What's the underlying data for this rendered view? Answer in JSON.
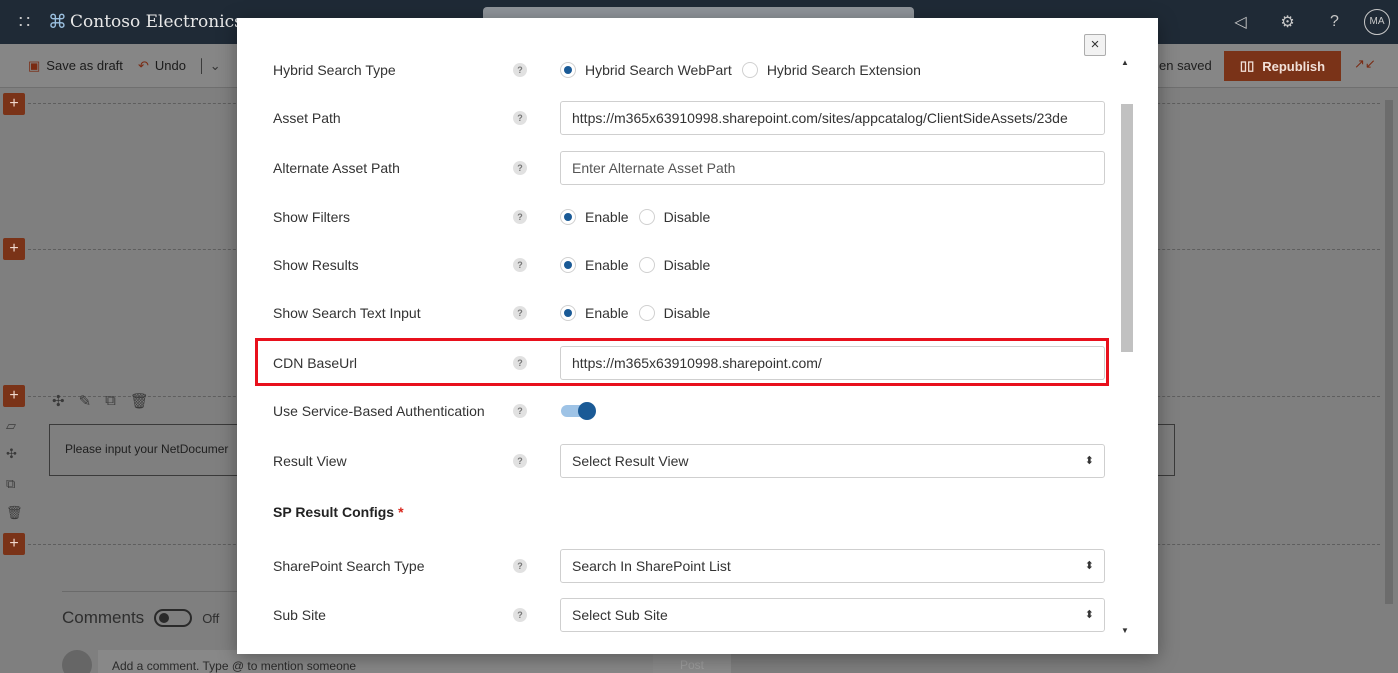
{
  "suitebar": {
    "waffle": "∷",
    "logo_glyph": "⌘",
    "brand": "Contoso Electronics",
    "avatar_initials": "MA"
  },
  "cmdbar": {
    "save_draft": "Save as draft",
    "undo": "Undo",
    "saved_status": "en saved",
    "republish": "Republish"
  },
  "page": {
    "input_text": "Please input your NetDocumer",
    "comments_title": "Comments",
    "comments_toggle": "Off",
    "comment_placeholder": "Add a comment. Type @ to mention someone",
    "post_label": "Post"
  },
  "modal": {
    "close": "×",
    "help_glyph": "?",
    "hybrid_search_type": {
      "label": "Hybrid Search Type",
      "options": [
        "Hybrid Search WebPart",
        "Hybrid Search Extension"
      ],
      "selected": "Hybrid Search WebPart"
    },
    "asset_path": {
      "label": "Asset Path",
      "value": "https://m365x63910998.sharepoint.com/sites/appcatalog/ClientSideAssets/23de"
    },
    "alternate_asset_path": {
      "label": "Alternate Asset Path",
      "placeholder": "Enter Alternate Asset Path"
    },
    "show_filters": {
      "label": "Show Filters",
      "options": [
        "Enable",
        "Disable"
      ],
      "selected": "Enable"
    },
    "show_results": {
      "label": "Show Results",
      "options": [
        "Enable",
        "Disable"
      ],
      "selected": "Enable"
    },
    "show_search_text_input": {
      "label": "Show Search Text Input",
      "options": [
        "Enable",
        "Disable"
      ],
      "selected": "Enable"
    },
    "cdn_base_url": {
      "label": "CDN BaseUrl",
      "value": "https://m365x63910998.sharepoint.com/"
    },
    "service_auth": {
      "label": "Use Service-Based Authentication",
      "enabled": true
    },
    "result_view": {
      "label": "Result View",
      "value": "Select Result View"
    },
    "sp_result_configs": {
      "title": "SP Result Configs",
      "required_mark": "*"
    },
    "sharepoint_search_type": {
      "label": "SharePoint Search Type",
      "value": "Search In SharePoint List"
    },
    "sub_site": {
      "label": "Sub Site",
      "value": "Select Sub Site"
    }
  },
  "colors": {
    "accent": "#1a5a96",
    "highlight": "#e8101c",
    "brand_button": "#7a3318"
  }
}
